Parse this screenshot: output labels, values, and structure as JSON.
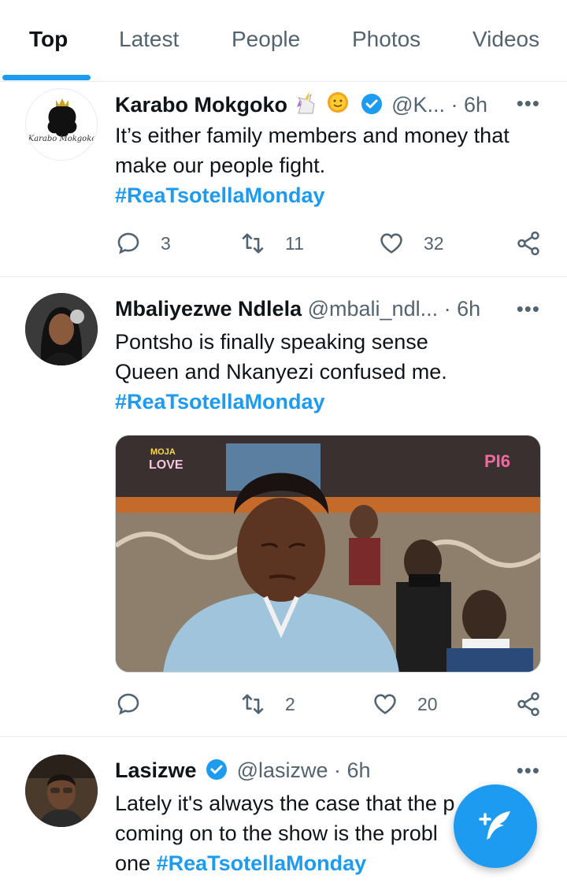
{
  "tabs": [
    {
      "label": "Top",
      "active": true
    },
    {
      "label": "Latest",
      "active": false
    },
    {
      "label": "People",
      "active": false
    },
    {
      "label": "Photos",
      "active": false
    },
    {
      "label": "Videos",
      "active": false
    }
  ],
  "accent_color": "#1d9bf0",
  "tweets": [
    {
      "name": "Karabo Mokgoko",
      "emojis": [
        "unicorn",
        "sun-with-face"
      ],
      "verified": true,
      "handle": "@K...",
      "time": "· 6h",
      "avatar_text": "Karabo Mokgoko",
      "lines": [
        "It’s either family members and money that",
        "make our people fight."
      ],
      "hashtag": "#ReaTsotellaMonday",
      "replies": "3",
      "retweets": "11",
      "likes": "32"
    },
    {
      "name": "Mbaliyezwe Ndlela",
      "verified": false,
      "handle": "@mbali_ndl...",
      "time": "· 6h",
      "lines": [
        "Pontsho is finally speaking sense",
        "Queen and Nkanyezi confused me."
      ],
      "hashtag": "#ReaTsotellaMonday",
      "media": {
        "logo_top": "MOJA",
        "logo_bottom": "LOVE",
        "rating": "PI6"
      },
      "replies": "",
      "retweets": "2",
      "likes": "20"
    },
    {
      "name": "Lasizwe",
      "verified": true,
      "handle": "@lasizwe",
      "time": "· 6h",
      "lines": [
        "Lately it's always the case that the p",
        "coming on to the show is the probl"
      ],
      "last_line_prefix": "one",
      "hashtag": "#ReaTsotellaMonday"
    }
  ],
  "more_label": "•••",
  "fab": {
    "icon": "compose-tweet-icon"
  }
}
